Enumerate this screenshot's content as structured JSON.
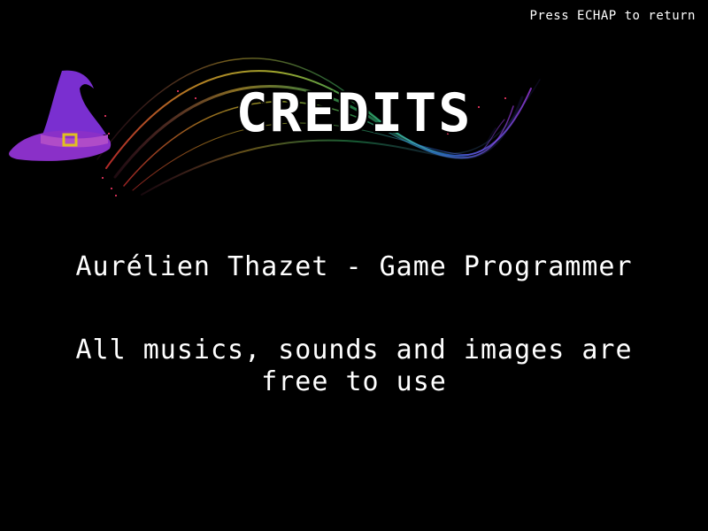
{
  "screen": {
    "hint": "Press ECHAP to return",
    "title": "CREDITS",
    "author_line": "Aurélien Thazet - Game Programmer",
    "note_line_1": "All musics, sounds and images are",
    "note_line_2": "free to use"
  },
  "icons": {
    "logo": "wizard-hat-icon",
    "swirl": "rainbow-swirl-decoration"
  },
  "colors": {
    "background": "#000000",
    "text": "#ffffff",
    "hat": "#7a2fd0",
    "hat_band": "#b04cc8",
    "buckle": "#e0c020"
  }
}
